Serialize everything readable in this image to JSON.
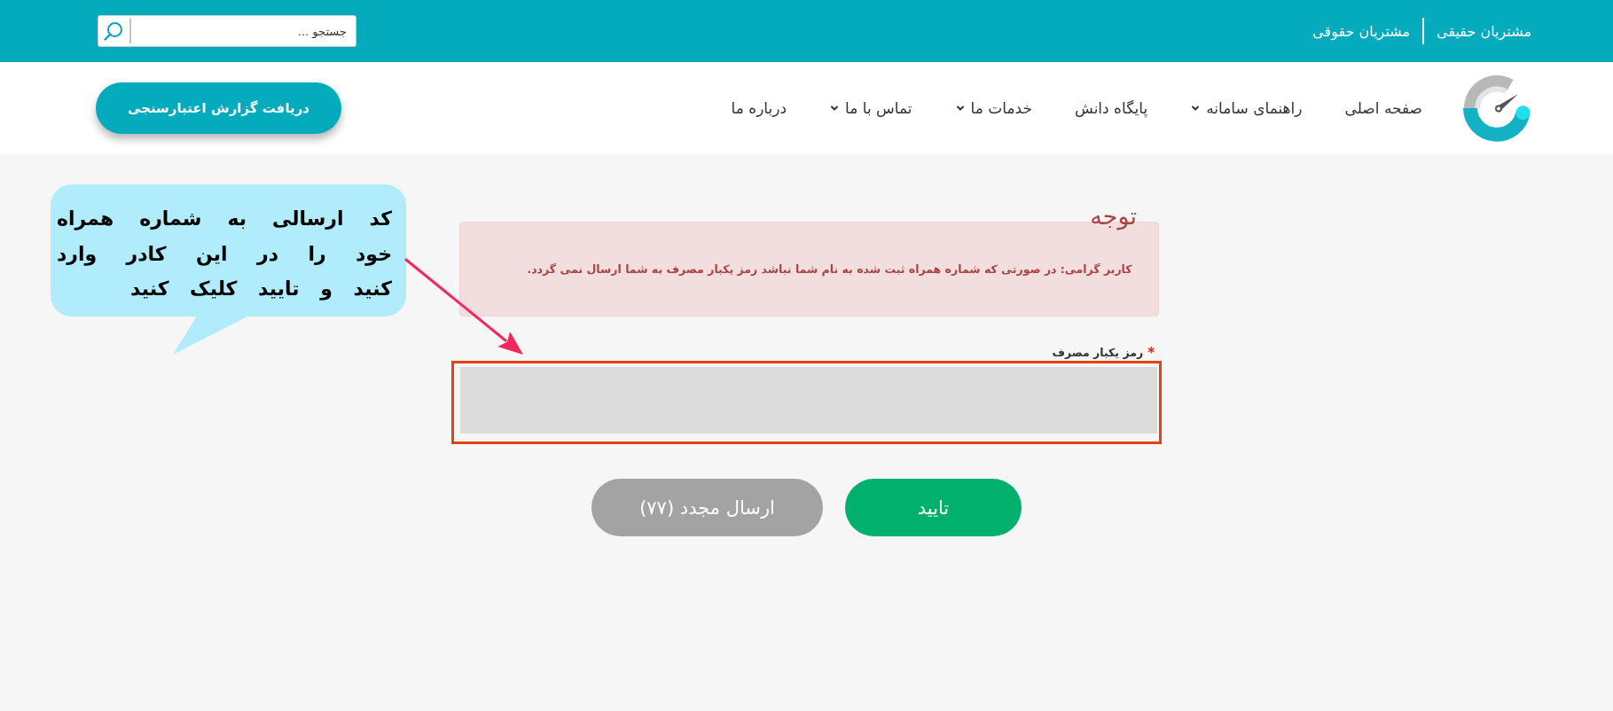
{
  "top_bar": {
    "links": [
      {
        "label": "مشتریان حقیقی"
      },
      {
        "label": "مشتریان حقوقی"
      }
    ],
    "search": {
      "placeholder": "جستجو ..."
    }
  },
  "nav": {
    "menu": [
      {
        "label": "صفحه اصلی",
        "has_menu": false
      },
      {
        "label": "راهنمای سامانه",
        "has_menu": true
      },
      {
        "label": "پایگاه دانش",
        "has_menu": false
      },
      {
        "label": "خدمات ما",
        "has_menu": true
      },
      {
        "label": "تماس با ما",
        "has_menu": true
      },
      {
        "label": "درباره ما",
        "has_menu": false
      }
    ],
    "report_button": "دریافت گزارش اعتبارسنجی"
  },
  "notice": {
    "title": "توجه",
    "message": "کاربر گرامی: در صورتی که شماره همراه ثبت شده به نام شما نباشد رمز یکبار مصرف به شما ارسال نمی گردد."
  },
  "otp_field": {
    "label": "رمز یکبار مصرف",
    "required_mark": "*"
  },
  "buttons": [
    {
      "label": "تایید",
      "kind": "confirm",
      "disabled": false
    },
    {
      "label": "ارسال مجدد (۷۷)",
      "kind": "resend",
      "disabled": true
    }
  ],
  "annotation": {
    "text": "کد ارسالی به شماره همراه خود را در این کادر وارد کنید و تایید کلیک کنید"
  }
}
